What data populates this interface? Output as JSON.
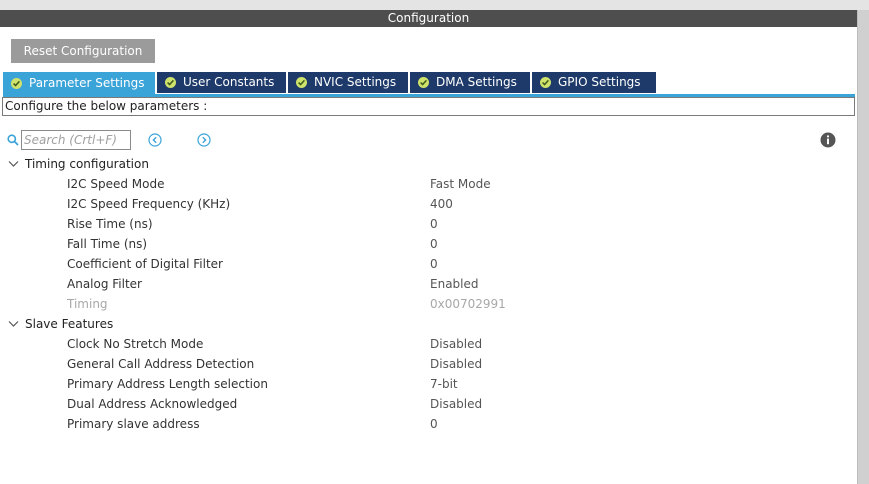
{
  "window": {
    "title": "Configuration"
  },
  "toolbar": {
    "reset_label": "Reset Configuration"
  },
  "tabs": [
    {
      "label": "Parameter Settings",
      "active": true
    },
    {
      "label": "User Constants",
      "active": false
    },
    {
      "label": "NVIC Settings",
      "active": false
    },
    {
      "label": "DMA Settings",
      "active": false
    },
    {
      "label": "GPIO Settings",
      "active": false
    }
  ],
  "description": "Configure the below parameters :",
  "search": {
    "placeholder": "Search (Crtl+F)",
    "value": ""
  },
  "groups": [
    {
      "title": "Timing configuration",
      "params": [
        {
          "name": "I2C Speed Mode",
          "value": "Fast Mode"
        },
        {
          "name": "I2C Speed Frequency (KHz)",
          "value": "400"
        },
        {
          "name": "Rise Time (ns)",
          "value": "0"
        },
        {
          "name": "Fall Time (ns)",
          "value": "0"
        },
        {
          "name": "Coefficient of Digital Filter",
          "value": "0"
        },
        {
          "name": "Analog Filter",
          "value": "Enabled"
        },
        {
          "name": "Timing",
          "value": "0x00702991",
          "disabled": true
        }
      ]
    },
    {
      "title": "Slave Features",
      "params": [
        {
          "name": "Clock No Stretch Mode",
          "value": "Disabled"
        },
        {
          "name": "General Call Address Detection",
          "value": "Disabled"
        },
        {
          "name": "Primary Address Length selection",
          "value": "7-bit"
        },
        {
          "name": "Dual Address Acknowledged",
          "value": "Disabled"
        },
        {
          "name": "Primary slave address",
          "value": "0"
        }
      ]
    }
  ],
  "icons": {
    "search": "search-icon",
    "prev": "circle-chevron-left-icon",
    "next": "circle-chevron-right-icon",
    "info": "info-icon",
    "tab_status": "check-circle-icon",
    "group_toggle": "chevron-down-icon"
  },
  "colors": {
    "title_bar": "#4e4e4e",
    "active_tab": "#3aa3d8",
    "inactive_tab": "#1d3a6a",
    "tab_check": "#cfe26b",
    "nav_arrows": "#3aa3d8"
  }
}
